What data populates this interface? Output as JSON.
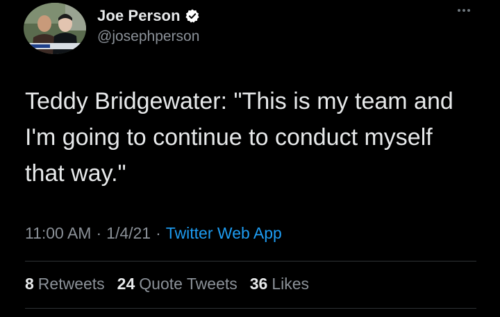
{
  "author": {
    "display_name": "Joe Person",
    "handle": "@josephperson",
    "verified_icon": "verified-badge-icon",
    "avatar_icon": "avatar-photo"
  },
  "menu": {
    "more_icon": "more-options-icon"
  },
  "tweet": {
    "text": "Teddy Bridgewater: \"This is my team and I'm going to continue to conduct myself that way.\"",
    "time": "11:00 AM",
    "separator": "·",
    "date": "1/4/21",
    "source": "Twitter Web App"
  },
  "stats": {
    "retweets": {
      "count": "8",
      "label": "Retweets"
    },
    "quote_tweets": {
      "count": "24",
      "label": "Quote Tweets"
    },
    "likes": {
      "count": "36",
      "label": "Likes"
    }
  },
  "colors": {
    "background": "#000000",
    "text_primary": "#e7e9ea",
    "text_secondary": "#8b9198",
    "link": "#1d9bf0",
    "divider": "#2f3336"
  }
}
